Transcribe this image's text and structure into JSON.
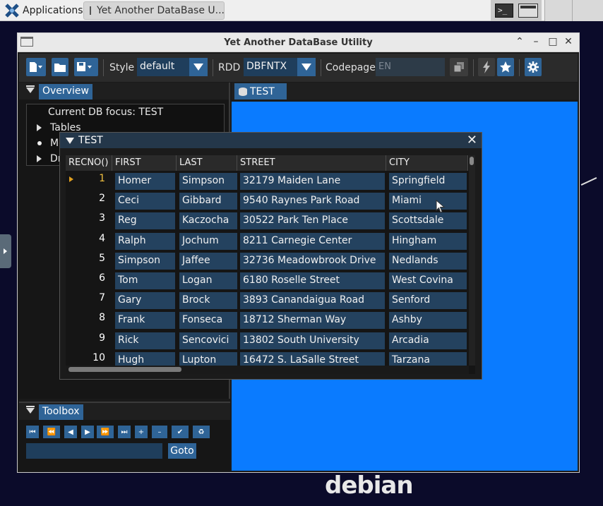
{
  "taskbar": {
    "applications_label": "Applications",
    "task_title": "Yet Another DataBase U..."
  },
  "window": {
    "title": "Yet Another DataBase Utility"
  },
  "toolbar": {
    "style_label": "Style",
    "style_value": "default",
    "rdd_label": "RDD",
    "rdd_value": "DBFNTX",
    "codepage_label": "Codepage",
    "codepage_placeholder": "EN"
  },
  "overview": {
    "tab_label": "Overview",
    "focus_text": "Current DB focus: TEST",
    "items": [
      "Tables",
      "Me",
      "Dr"
    ]
  },
  "right_tab": {
    "label": "TEST"
  },
  "dialog": {
    "title": "TEST",
    "columns": [
      "RECNO()",
      "FIRST",
      "LAST",
      "STREET",
      "CITY"
    ],
    "rows": [
      {
        "recno": "1",
        "first": "Homer",
        "last": "Simpson",
        "street": "32179 Maiden Lane",
        "city": "Springfield"
      },
      {
        "recno": "2",
        "first": "Ceci",
        "last": "Gibbard",
        "street": "9540 Raynes Park Road",
        "city": "Miami"
      },
      {
        "recno": "3",
        "first": "Reg",
        "last": "Kaczocha",
        "street": "30522 Park Ten Place",
        "city": "Scottsdale"
      },
      {
        "recno": "4",
        "first": "Ralph",
        "last": "Jochum",
        "street": "8211 Carnegie Center",
        "city": "Hingham"
      },
      {
        "recno": "5",
        "first": "Simpson",
        "last": "Jaffee",
        "street": "32736 Meadowbrook Drive",
        "city": "Nedlands"
      },
      {
        "recno": "6",
        "first": "Tom",
        "last": "Logan",
        "street": "6180 Roselle Street",
        "city": "West Covina"
      },
      {
        "recno": "7",
        "first": "Gary",
        "last": "Brock",
        "street": "3893 Canandaigua Road",
        "city": "Senford"
      },
      {
        "recno": "8",
        "first": "Frank",
        "last": "Fonseca",
        "street": "18712 Sherman Way",
        "city": "Ashby"
      },
      {
        "recno": "9",
        "first": "Rick",
        "last": "Sencovici",
        "street": "13802 South University",
        "city": "Arcadia"
      },
      {
        "recno": "10",
        "first": "Hugh",
        "last": "Lupton",
        "street": "16472 S. LaSalle Street",
        "city": "Tarzana"
      }
    ]
  },
  "toolbox": {
    "tab_label": "Toolbox",
    "goto_label": "Goto"
  },
  "wallpaper": {
    "brand": "debian"
  },
  "colors": {
    "accent": "#2f6497",
    "desktop_blue": "#0a7bff"
  }
}
